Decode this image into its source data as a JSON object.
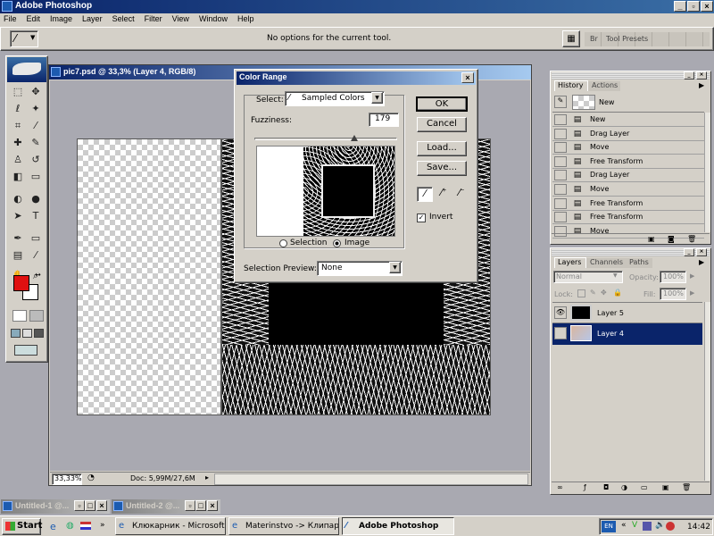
{
  "app": {
    "title": "Adobe Photoshop"
  },
  "menu": [
    "File",
    "Edit",
    "Image",
    "Layer",
    "Select",
    "Filter",
    "View",
    "Window",
    "Help"
  ],
  "options_bar": {
    "hint": "No options for the current tool.",
    "tool_presets": "Tool Presets",
    "brushes": "Br"
  },
  "document": {
    "title": "pic7.psd @ 33,3% (Layer 4, RGB/8)",
    "zoom": "33,33%",
    "doc_info": "Doc: 5,99M/27,6M"
  },
  "color_range": {
    "title": "Color Range",
    "select_label": "Select:",
    "select_value": "Sampled Colors",
    "fuzziness_label": "Fuzziness:",
    "fuzziness_value": "179",
    "fuzziness_fraction": 0.7,
    "radio_selection": "Selection",
    "radio_image": "Image",
    "preview_label": "Selection Preview:",
    "preview_value": "None",
    "ok": "OK",
    "cancel": "Cancel",
    "load": "Load...",
    "save": "Save...",
    "invert": "Invert"
  },
  "history": {
    "tab": "History",
    "tab2": "Actions",
    "snapshot": "New",
    "items": [
      "New",
      "Drag Layer",
      "Move",
      "Free Transform",
      "Drag Layer",
      "Move",
      "Free Transform",
      "Free Transform",
      "Move"
    ]
  },
  "layers": {
    "tabs": [
      "Layers",
      "Channels",
      "Paths"
    ],
    "blend": "Normal",
    "opacity_label": "Opacity:",
    "opacity": "100%",
    "lock_label": "Lock:",
    "fill_label": "Fill:",
    "fill": "100%",
    "items": [
      "Layer 5",
      "Layer 4"
    ]
  },
  "minimized": [
    "Untitled-1 @...",
    "Untitled-2 @..."
  ],
  "taskbar": {
    "start": "Start",
    "tasks": [
      "Клюкарник - Microsoft I...",
      "Materinstvo -> Клипарт...",
      "Adobe Photoshop"
    ],
    "lang": "EN",
    "clock": "14:42"
  },
  "colors": {
    "titlebar": "#0a246a",
    "foreground": "#e01010",
    "selection": "#0a246a"
  }
}
